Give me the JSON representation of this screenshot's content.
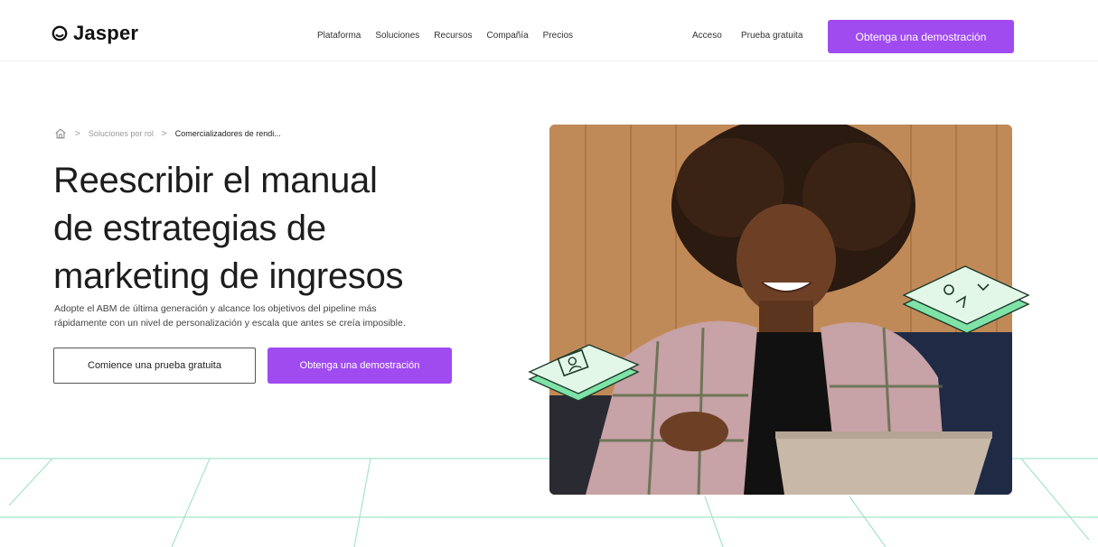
{
  "header": {
    "logo_text": "Jasper",
    "nav": [
      "Plataforma",
      "Soluciones",
      "Recursos",
      "Compañía",
      "Precios"
    ],
    "login": "Acceso",
    "free_trial": "Prueba gratuita",
    "cta": "Obtenga una demostración"
  },
  "breadcrumb": {
    "level1": "Soluciones por rol",
    "current": "Comercializadores de rendi...",
    "separator": ">"
  },
  "hero": {
    "title_line1": "Reescribir el manual",
    "title_line2": "de estrategias de",
    "title_line3": "marketing de ingresos",
    "subtitle_line1": "Adopte el ABM de última generación y alcance los objetivos del pipeline más",
    "subtitle_line2": "rápidamente con un nivel de personalización y escala que antes se creía imposible.",
    "secondary_button": "Comience una prueba gratuita",
    "primary_button": "Obtenga una demostración"
  },
  "colors": {
    "accent": "#a04bf0",
    "card_green": "#7fe3a8",
    "card_light": "#e3f7e8",
    "grid_line": "#a6e4c8"
  },
  "icons": {
    "logo": "jasper-logo-icon",
    "home": "home-icon",
    "profile_card": "profile-card-icon",
    "data_card": "data-card-icon"
  }
}
